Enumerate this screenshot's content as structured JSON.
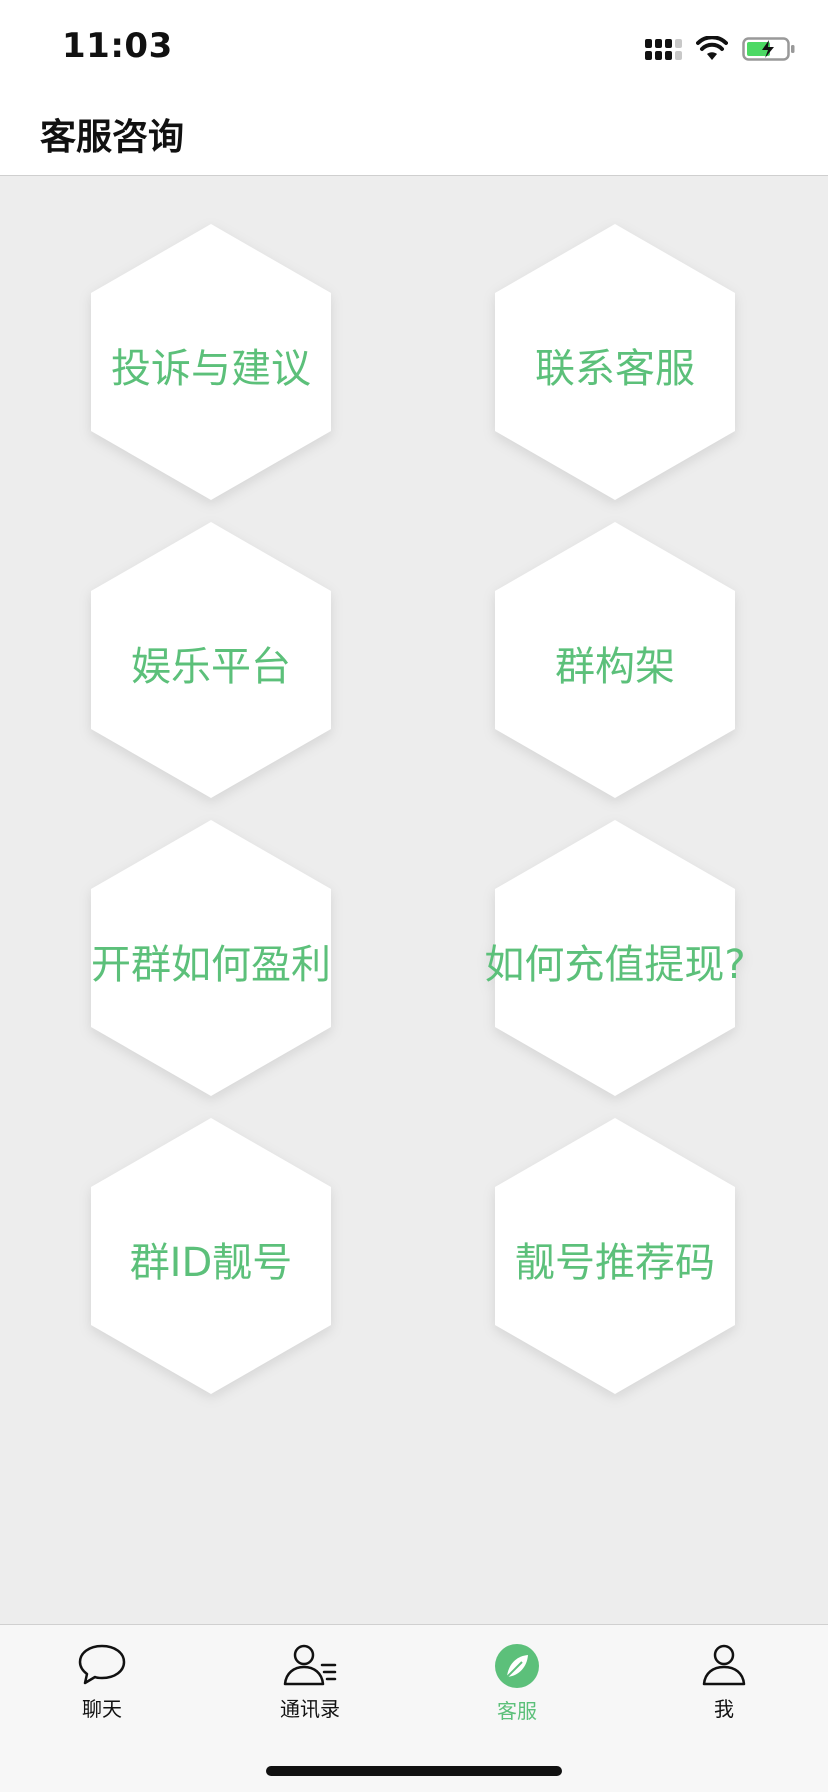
{
  "status_bar": {
    "time": "11:03"
  },
  "header": {
    "title": "客服咨询"
  },
  "menu": {
    "items": [
      {
        "label": "投诉与建议"
      },
      {
        "label": "联系客服"
      },
      {
        "label": "娱乐平台"
      },
      {
        "label": "群构架"
      },
      {
        "label": "开群如何盈利"
      },
      {
        "label": "如何充值提现?"
      },
      {
        "label": "群ID靓号"
      },
      {
        "label": "靓号推荐码"
      }
    ]
  },
  "tab_bar": {
    "tabs": [
      {
        "label": "聊天",
        "icon": "chat-bubble-icon"
      },
      {
        "label": "通讯录",
        "icon": "contacts-icon"
      },
      {
        "label": "客服",
        "icon": "leaf-compass-icon",
        "active": true
      },
      {
        "label": "我",
        "icon": "person-icon"
      }
    ]
  },
  "colors": {
    "accent": "#5cc07a",
    "background": "#ededed"
  }
}
